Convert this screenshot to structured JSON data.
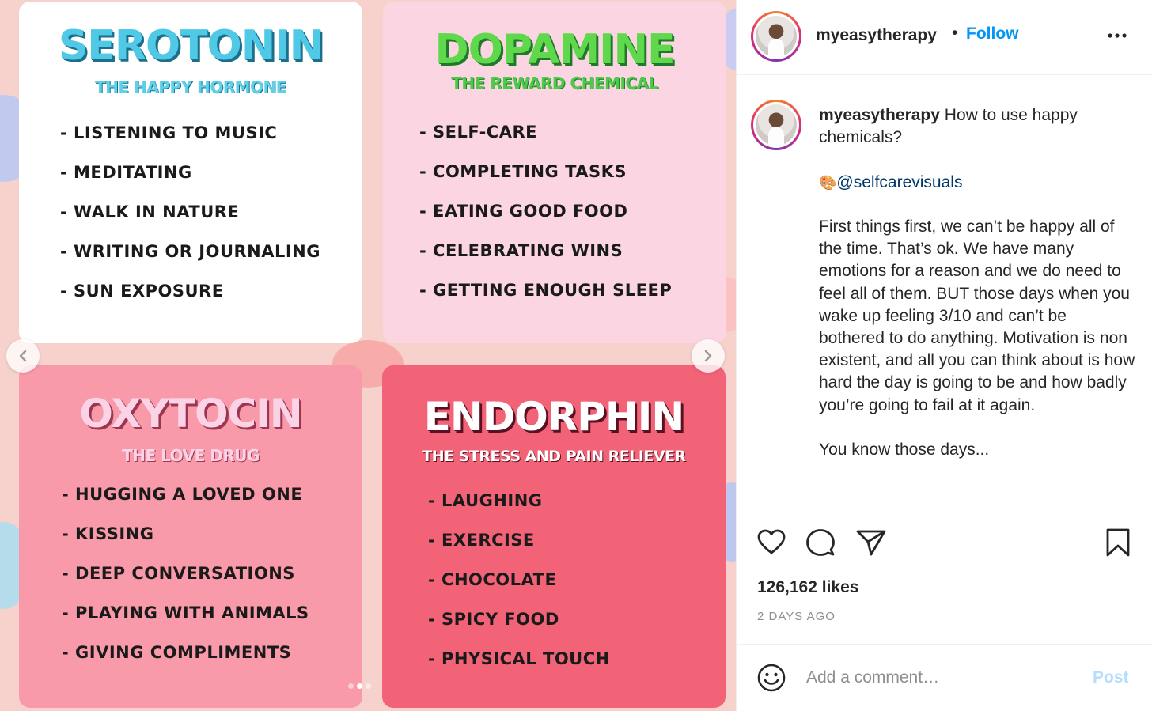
{
  "post": {
    "cards": [
      {
        "title": "SEROTONIN",
        "subtitle": "THE HAPPY HORMONE",
        "items": [
          "LISTENING TO MUSIC",
          "MEDITATING",
          "WALK IN NATURE",
          "WRITING OR JOURNALING",
          "SUN EXPOSURE"
        ],
        "bg": "#ffffff",
        "title_color": "#4fc9e6",
        "title_shadow": "#1b6f8a",
        "sub_color": "#5fd0ea"
      },
      {
        "title": "DOPAMINE",
        "subtitle": "THE REWARD CHEMICAL",
        "items": [
          "SELF-CARE",
          "COMPLETING TASKS",
          "EATING GOOD FOOD",
          "CELEBRATING WINS",
          "GETTING ENOUGH SLEEP"
        ],
        "bg": "#fbd6e2",
        "title_color": "#5fd94b",
        "title_shadow": "#1e7a2a",
        "sub_color": "#4fc94a"
      },
      {
        "title": "OXYTOCIN",
        "subtitle": "THE LOVE DRUG",
        "items": [
          "HUGGING A LOVED ONE",
          "KISSING",
          "DEEP CONVERSATIONS",
          "PLAYING WITH ANIMALS",
          "GIVING COMPLIMENTS"
        ],
        "bg": "#f89aa9",
        "title_color": "#fbd3e6",
        "title_shadow": "#9b3550",
        "sub_color": "#fbd3e6"
      },
      {
        "title": "ENDORPHIN",
        "subtitle": "THE STRESS AND PAIN RELIEVER",
        "items": [
          "LAUGHING",
          "EXERCISE",
          "CHOCOLATE",
          "SPICY FOOD",
          "PHYSICAL TOUCH"
        ],
        "bg": "#f26378",
        "title_color": "#ffffff",
        "title_shadow": "#5a1020",
        "sub_color": "#ffffff"
      }
    ],
    "carousel": {
      "slide_count": 3,
      "active_index": 1,
      "prev_icon": "chevron-left-icon",
      "next_icon": "chevron-right-icon"
    }
  },
  "header": {
    "username": "myeasytherapy",
    "separator": "•",
    "follow_label": "Follow",
    "more_icon": "more-options-icon"
  },
  "caption": {
    "username": "myeasytherapy",
    "headline": "How to use happy chemicals?",
    "mention_emoji": "🎨",
    "mention": "@selfcarevisuals",
    "body": "First things first, we can’t be happy all of the time. That’s ok. We have many emotions for a reason and we do need to feel all of them. BUT those days when you wake up feeling 3/10 and can’t be bothered to do anything. Motivation is non existent, and all you can think about is how hard the day is going to be and how badly you’re going to fail at it again.",
    "closing": "You know those days..."
  },
  "actions": {
    "like_icon": "heart-icon",
    "comment_icon": "comment-icon",
    "share_icon": "share-icon",
    "save_icon": "bookmark-icon"
  },
  "stats": {
    "likes": "126,162 likes",
    "time": "2 DAYS AGO"
  },
  "comment": {
    "emoji_icon": "emoji-icon",
    "placeholder": "Add a comment…",
    "post_label": "Post"
  },
  "colors": {
    "follow": "#0095f6",
    "post_disabled": "#b2dffc",
    "mention": "#00376b",
    "muted": "#8e8e8e"
  }
}
